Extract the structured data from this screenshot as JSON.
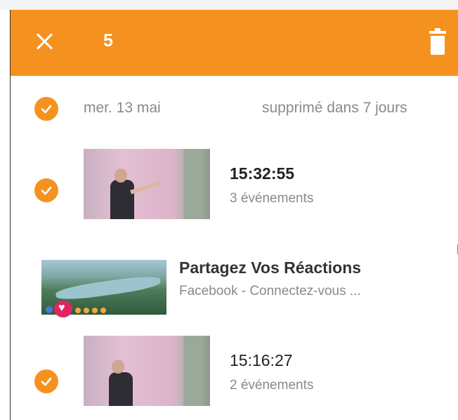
{
  "appbar": {
    "selected_count": "5",
    "color": "#f5921f"
  },
  "group": {
    "date": "mer. 13 mai",
    "deletion_note": "supprimé dans 7 jours"
  },
  "items": [
    {
      "time": "15:32:55",
      "events": "3 événements"
    },
    {
      "time": "15:16:27",
      "events": "2 événements"
    }
  ],
  "ad": {
    "title": "Partagez Vos Réactions",
    "subtitle": "Facebook - Connectez-vous ..."
  },
  "icons": {
    "close": "close-icon",
    "delete": "trash-icon",
    "check": "check-icon"
  }
}
